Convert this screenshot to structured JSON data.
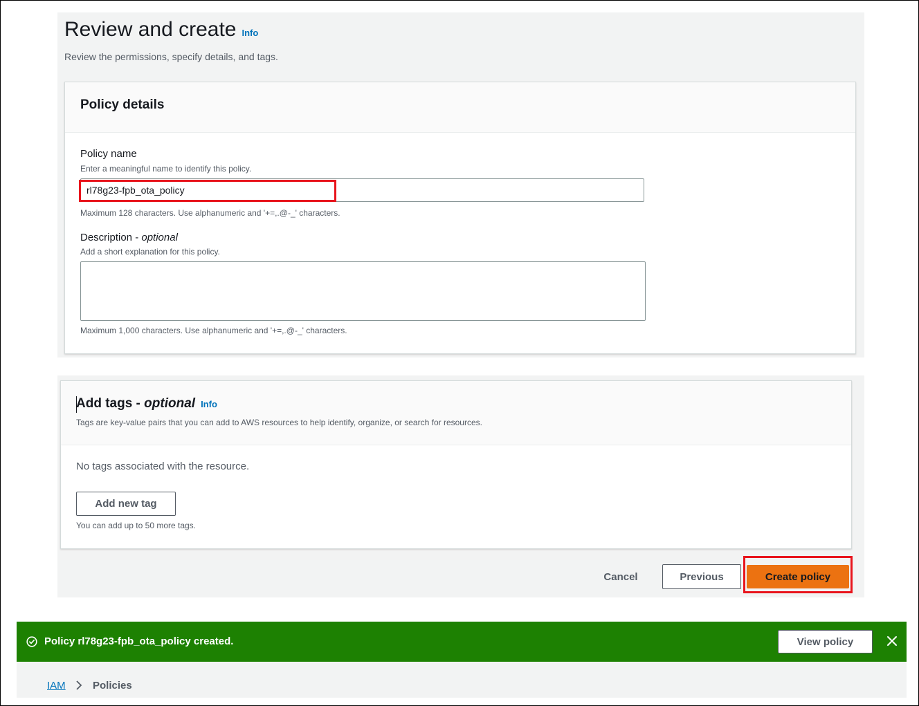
{
  "page": {
    "title": "Review and create",
    "info_label": "Info",
    "subtitle": "Review the permissions, specify details, and tags."
  },
  "policy_details": {
    "heading": "Policy details",
    "name_label": "Policy name",
    "name_description": "Enter a meaningful name to identify this policy.",
    "name_value": "rl78g23-fpb_ota_policy",
    "name_constraint": "Maximum 128 characters. Use alphanumeric and '+=,.@-_' characters.",
    "description_label": "Description - ",
    "description_optional": "optional",
    "description_hint": "Add a short explanation for this policy.",
    "description_value": "",
    "description_constraint": "Maximum 1,000 characters. Use alphanumeric and '+=,.@-_' characters."
  },
  "tags": {
    "title": "Add tags - ",
    "title_optional": "optional",
    "info_label": "Info",
    "description": "Tags are key-value pairs that you can add to AWS resources to help identify, organize, or search for resources.",
    "empty_message": "No tags associated with the resource.",
    "add_button": "Add new tag",
    "limit_text": "You can add up to 50 more tags."
  },
  "actions": {
    "cancel": "Cancel",
    "previous": "Previous",
    "create": "Create policy"
  },
  "flash": {
    "message": "Policy rl78g23-fpb_ota_policy created.",
    "view_button": "View policy",
    "status": "success",
    "color": "#1d8102"
  },
  "breadcrumb": {
    "root": "IAM",
    "current": "Policies"
  },
  "colors": {
    "primary_button": "#ec7211",
    "link": "#0073bb",
    "highlight": "#e8141c"
  }
}
